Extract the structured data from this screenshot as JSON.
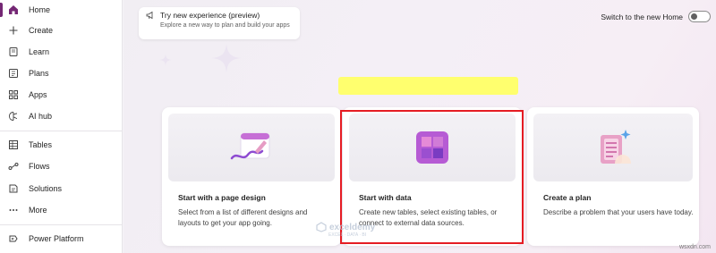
{
  "sidebar": {
    "items": [
      {
        "label": "Home",
        "icon": "home-icon"
      },
      {
        "label": "Create",
        "icon": "plus-icon"
      },
      {
        "label": "Learn",
        "icon": "book-icon"
      },
      {
        "label": "Plans",
        "icon": "plans-icon"
      },
      {
        "label": "Apps",
        "icon": "apps-icon"
      },
      {
        "label": "AI hub",
        "icon": "brain-icon"
      },
      {
        "label": "Tables",
        "icon": "table-icon"
      },
      {
        "label": "Flows",
        "icon": "flow-icon"
      },
      {
        "label": "Solutions",
        "icon": "solutions-icon"
      },
      {
        "label": "More",
        "icon": "more-icon"
      },
      {
        "label": "Power Platform",
        "icon": "power-platform-icon"
      }
    ],
    "active": "Home",
    "accent_color": "#742774"
  },
  "header": {
    "try_title": "Try new experience (preview)",
    "try_desc": "Explore a new way to plan and build your apps",
    "switch_label": "Switch to the new Home"
  },
  "cards": [
    {
      "title": "Start with a page design",
      "desc": "Select from a list of different designs and layouts to get your app going."
    },
    {
      "title": "Start with data",
      "desc": "Create new tables, select existing tables, or connect to external data sources."
    },
    {
      "title": "Create a plan",
      "desc": "Describe a problem that your users have today."
    }
  ],
  "watermark": {
    "brand": "exceldemy",
    "tagline": "EXCEL · DATA · BI",
    "corner": "wsxdn.com"
  },
  "colors": {
    "highlight": "#e51c23",
    "yellow_bar": "#ffff6e"
  }
}
